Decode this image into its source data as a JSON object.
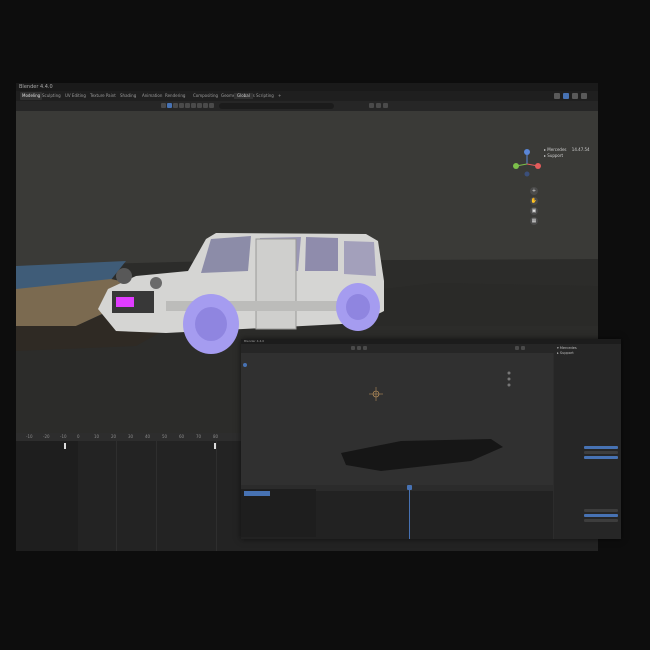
{
  "window": {
    "title": "Blender 4.4.0",
    "tabs": [
      "Modeling",
      "Sculpting",
      "UV Editing",
      "Texture Paint",
      "Shading",
      "Animation",
      "Rendering",
      "Compositing",
      "Geometry Nodes",
      "Scripting",
      "+"
    ],
    "active_tab": 0
  },
  "toolbar": {
    "view_mode": "Global",
    "search_placeholder": "🔍"
  },
  "scene": {
    "collection_label": "Mercedes",
    "collection_value": "14.47.54",
    "support_label": "Support"
  },
  "timeline": {
    "frames": [
      "-10",
      "-20",
      "-10",
      "0",
      "10",
      "20",
      "30",
      "40",
      "50",
      "60",
      "70",
      "80"
    ]
  },
  "colors": {
    "accent": "#4772b3",
    "wheel": "#a59cf0",
    "plate": "#e03cff",
    "body": "#d5d5d3"
  }
}
